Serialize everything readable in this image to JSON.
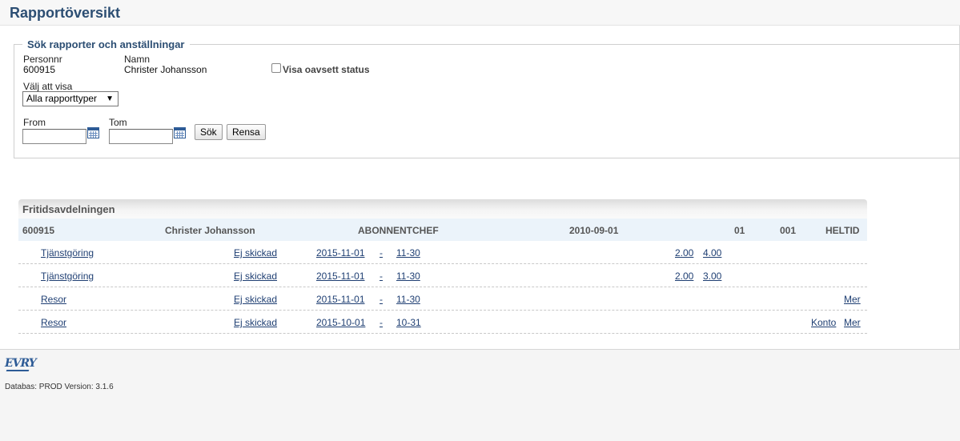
{
  "page": {
    "title": "Rapportöversikt"
  },
  "search": {
    "legend": "Sök rapporter och anställningar",
    "personnr_label": "Personnr",
    "personnr_value": "600915",
    "name_label": "Namn",
    "name_value": "Christer Johansson",
    "show_all_status_label": "Visa oavsett status",
    "report_type_label": "Välj att visa",
    "report_type_selected": "Alla rapporttyper",
    "from_label": "From",
    "to_label": "Tom",
    "search_button": "Sök",
    "clear_button": "Rensa"
  },
  "group": {
    "title": "Fritidsavdelningen",
    "employee": {
      "personnr": "600915",
      "name": "Christer Johansson",
      "role": "ABONNENTCHEF",
      "date": "2010-09-01",
      "code1": "01",
      "code2": "001",
      "type": "HELTID"
    },
    "reports": [
      {
        "type": "Tjänstgöring",
        "status": "Ej skickad",
        "from": "2015-11-01",
        "sep": "-",
        "to": "11-30",
        "v1": "2.00",
        "v2": "4.00",
        "konto": "",
        "mer": ""
      },
      {
        "type": "Tjänstgöring",
        "status": "Ej skickad",
        "from": "2015-11-01",
        "sep": "-",
        "to": "11-30",
        "v1": "2.00",
        "v2": "3.00",
        "konto": "",
        "mer": ""
      },
      {
        "type": "Resor",
        "status": "Ej skickad",
        "from": "2015-11-01",
        "sep": "-",
        "to": "11-30",
        "v1": "",
        "v2": "",
        "konto": "",
        "mer": "Mer"
      },
      {
        "type": "Resor",
        "status": "Ej skickad",
        "from": "2015-10-01",
        "sep": "-",
        "to": "10-31",
        "v1": "",
        "v2": "",
        "konto": "Konto",
        "mer": "Mer"
      }
    ]
  },
  "footer": {
    "logo": "EVRY",
    "info": "Databas: PROD Version: 3.1.6"
  }
}
